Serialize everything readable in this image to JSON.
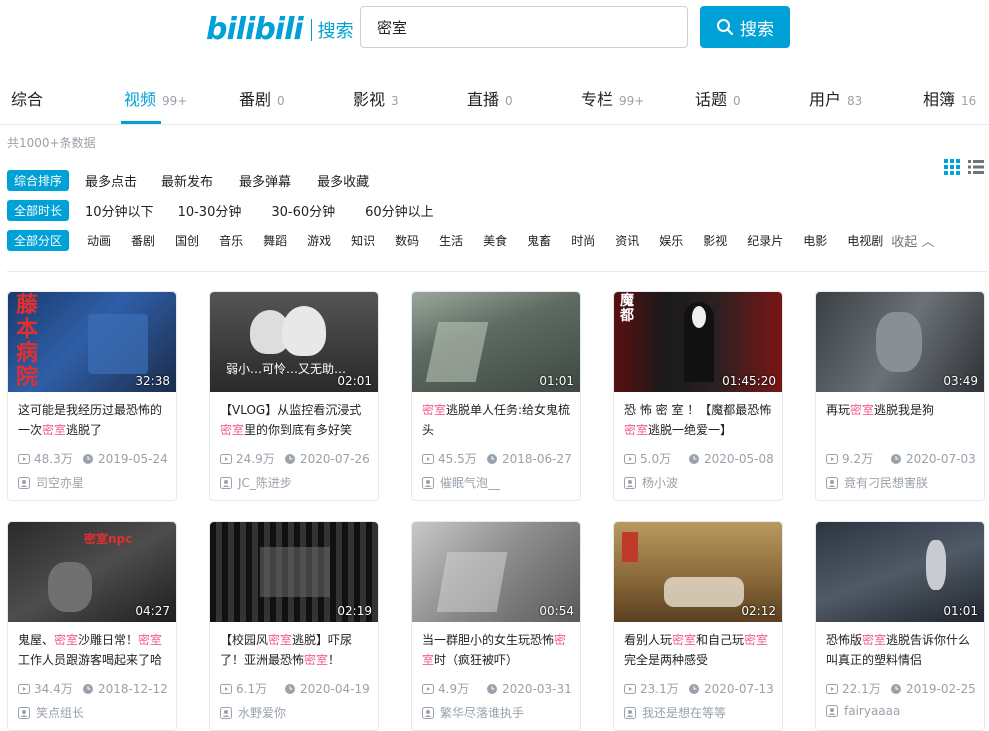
{
  "header": {
    "logo": "bilibili",
    "logo_sub": "搜索",
    "search_value": "密室",
    "search_button": "搜索"
  },
  "tabs": [
    {
      "label": "综合",
      "count": ""
    },
    {
      "label": "视频",
      "count": "99+"
    },
    {
      "label": "番剧",
      "count": "0"
    },
    {
      "label": "影视",
      "count": "3"
    },
    {
      "label": "直播",
      "count": "0"
    },
    {
      "label": "专栏",
      "count": "99+"
    },
    {
      "label": "话题",
      "count": "0"
    },
    {
      "label": "用户",
      "count": "83"
    },
    {
      "label": "相簿",
      "count": "16"
    }
  ],
  "total_text": "共1000+条数据",
  "filters": {
    "sort": {
      "tag": "综合排序",
      "items": [
        "最多点击",
        "最新发布",
        "最多弹幕",
        "最多收藏"
      ]
    },
    "duration": {
      "tag": "全部时长",
      "items": [
        "10分钟以下",
        "10-30分钟",
        "30-60分钟",
        "60分钟以上"
      ]
    },
    "zone": {
      "tag": "全部分区",
      "items": [
        "动画",
        "番剧",
        "国创",
        "音乐",
        "舞蹈",
        "游戏",
        "知识",
        "数码",
        "生活",
        "美食",
        "鬼畜",
        "时尚",
        "资讯",
        "娱乐",
        "影视",
        "纪录片",
        "电影",
        "电视剧"
      ],
      "collapse": "收起"
    }
  },
  "videos": [
    {
      "pre": "这可能是我经历过最恐怖的一次",
      "hl": "密室",
      "post": "逃脱了",
      "duration": "32:38",
      "views": "48.3万",
      "date": "2019-05-24",
      "up": "司空亦星",
      "thumb_text": "藤本病院"
    },
    {
      "pre": "【VLOG】从监控看沉浸式",
      "hl": "密室",
      "post": "里的你到底有多好笑",
      "duration": "02:01",
      "views": "24.9万",
      "date": "2020-07-26",
      "up": "JC_陈进步",
      "thumb_text": "弱小…可怜…又无助…"
    },
    {
      "pre": "",
      "hl": "密室",
      "post": "逃脱单人任务:给女鬼梳头",
      "duration": "01:01",
      "views": "45.5万",
      "date": "2018-06-27",
      "up": "催眠气泡__",
      "thumb_text": ""
    },
    {
      "pre": "恐 怖 密 室 ！【魔都最恐怖",
      "hl": "密室",
      "post": "逃脱一绝爱一】",
      "duration": "01:45:20",
      "views": "5.0万",
      "date": "2020-05-08",
      "up": "杨小波",
      "thumb_text": "魔都"
    },
    {
      "pre": "再玩",
      "hl": "密室",
      "post": "逃脱我是狗",
      "duration": "03:49",
      "views": "9.2万",
      "date": "2020-07-03",
      "up": "竟有刁民想害朕",
      "thumb_text": ""
    },
    {
      "pre": "鬼屋、",
      "hl": "密室",
      "post": "沙雕日常！",
      "hl2": "密室",
      "post2": "工作人员跟游客喝起来了哈",
      "duration": "04:27",
      "views": "34.4万",
      "date": "2018-12-12",
      "up": "笑点组长",
      "thumb_text": "密室npc"
    },
    {
      "pre": "【校园风",
      "hl": "密室",
      "post": "逃脱】吓尿了！亚洲最恐怖",
      "hl2": "密室",
      "post2": "！",
      "duration": "02:19",
      "views": "6.1万",
      "date": "2020-04-19",
      "up": "水野爱你",
      "thumb_text": ""
    },
    {
      "pre": "当一群胆小的女生玩恐怖",
      "hl": "密室",
      "post": "时（疯狂被吓）",
      "duration": "00:54",
      "views": "4.9万",
      "date": "2020-03-31",
      "up": "繁华尽落谁执手",
      "thumb_text": ""
    },
    {
      "pre": "看别人玩",
      "hl": "密室",
      "post": "和自己玩",
      "hl2": "密室",
      "post2": "完全是两种感受",
      "duration": "02:12",
      "views": "23.1万",
      "date": "2020-07-13",
      "up": "我还是想在等等",
      "thumb_text": ""
    },
    {
      "pre": "恐怖版",
      "hl": "密室",
      "post": "逃脱告诉你什么叫真正的塑料情侣",
      "duration": "01:01",
      "views": "22.1万",
      "date": "2019-02-25",
      "up": "fairyaaaa",
      "thumb_text": ""
    }
  ],
  "colors": {
    "accent": "#00a1d6",
    "highlight": "#f25d8e",
    "muted": "#99a2aa"
  }
}
